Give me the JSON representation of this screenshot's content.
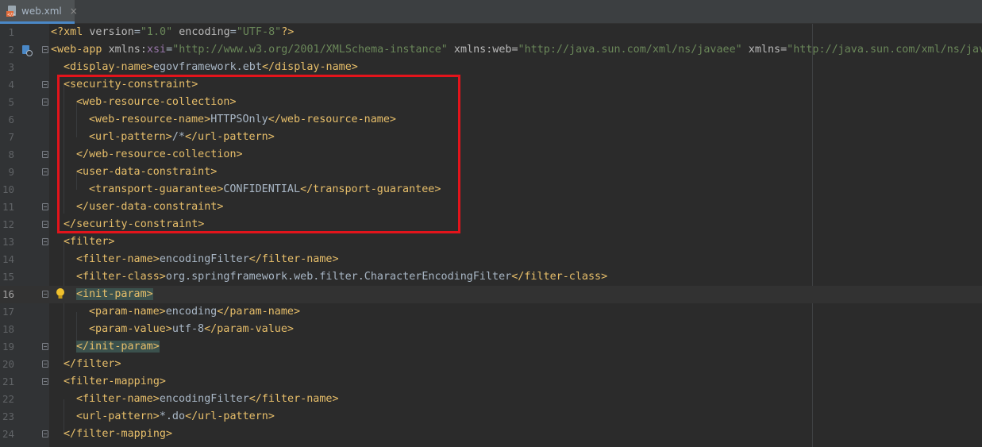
{
  "tab": {
    "filename": "web.xml",
    "close": "×",
    "icon": "xml-file-icon"
  },
  "gutter": {
    "line_numbers": [
      "1",
      "2",
      "3",
      "4",
      "5",
      "6",
      "7",
      "8",
      "9",
      "10",
      "11",
      "12",
      "13",
      "14",
      "15",
      "16",
      "17",
      "18",
      "19",
      "20",
      "21",
      "22",
      "23",
      "24"
    ],
    "current_line": "16",
    "icons": [
      "implementation-marker-icon",
      "lightbulb-icon"
    ]
  },
  "code": {
    "l1": {
      "a": "<?xml ",
      "b": "version",
      "c": "=",
      "d": "\"1.0\"",
      "e": " ",
      "f": "encoding",
      "g": "=",
      "h": "\"UTF-8\"",
      "i": "?>"
    },
    "l2": {
      "a": "<web-app ",
      "b": "xmlns:",
      "c": "xsi",
      "d": "=",
      "e": "\"http://www.w3.org/2001/XMLSchema-instance\"",
      "f": " xmlns:web=",
      "g": "\"http://java.sun.com/xml/ns/javaee\"",
      "h": " xmlns=",
      "i": "\"http://java.sun.com/xml/ns/java"
    },
    "l3": {
      "open": "<display-name>",
      "text": "egovframework.ebt",
      "close": "</display-name>"
    },
    "l4": {
      "open": "<security-constraint>"
    },
    "l5": {
      "open": "<web-resource-collection>"
    },
    "l6": {
      "open": "<web-resource-name>",
      "text": "HTTPSOnly",
      "close": "</web-resource-name>"
    },
    "l7": {
      "open": "<url-pattern>",
      "text": "/*",
      "close": "</url-pattern>"
    },
    "l8": {
      "open": "</web-resource-collection>"
    },
    "l9": {
      "open": "<user-data-constraint>"
    },
    "l10": {
      "open": "<transport-guarantee>",
      "text": "CONFIDENTIAL",
      "close": "</transport-guarantee>"
    },
    "l11": {
      "open": "</user-data-constraint>"
    },
    "l12": {
      "open": "</security-constraint>"
    },
    "l13": {
      "open": "<filter>"
    },
    "l14": {
      "open": "<filter-name>",
      "text": "encodingFilter",
      "close": "</filter-name>"
    },
    "l15": {
      "open": "<filter-class>",
      "text": "org.springframework.web.filter.CharacterEncodingFilter",
      "close": "</filter-class>"
    },
    "l16": {
      "open": "<init-param>"
    },
    "l17": {
      "open": "<param-name>",
      "text": "encoding",
      "close": "</param-name>"
    },
    "l18": {
      "open": "<param-value>",
      "text": "utf-8",
      "close": "</param-value>"
    },
    "l19": {
      "open": "</init-param>"
    },
    "l20": {
      "open": "</filter>"
    },
    "l21": {
      "open": "<filter-mapping>"
    },
    "l22": {
      "open": "<filter-name>",
      "text": "encodingFilter",
      "close": "</filter-name>"
    },
    "l23": {
      "open": "<url-pattern>",
      "text": "*.do",
      "close": "</url-pattern>"
    },
    "l24": {
      "open": "</filter-mapping>"
    }
  },
  "colors": {
    "background": "#2b2b2b",
    "tag": "#e8bf6a",
    "attribute": "#bababa",
    "string": "#6a8759",
    "text": "#a9b7c6",
    "highlight_box": "#e3141b"
  }
}
